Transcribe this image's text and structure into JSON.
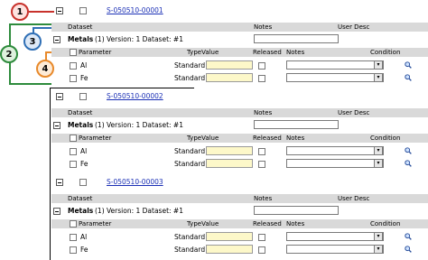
{
  "callouts": {
    "c1": "1",
    "c2": "2",
    "c3": "3",
    "c4": "4"
  },
  "headers": {
    "dataset": "Dataset",
    "notes": "Notes",
    "user_desc": "User Desc",
    "parameter": "Parameter",
    "typevalue": "TypeValue",
    "released": "Released",
    "notes2": "Notes",
    "condition": "Condition"
  },
  "samples": [
    {
      "id": "S-050510-00001",
      "dataset_name": "Metals",
      "dataset_meta": " (1) Version: 1 Dataset: #1",
      "params": [
        {
          "name": "Al",
          "type": "Standard"
        },
        {
          "name": "Fe",
          "type": "Standard"
        }
      ]
    },
    {
      "id": "S-050510-00002",
      "dataset_name": "Metals",
      "dataset_meta": " (1) Version: 1 Dataset: #1",
      "params": [
        {
          "name": "Al",
          "type": "Standard"
        },
        {
          "name": "Fe",
          "type": "Standard"
        }
      ]
    },
    {
      "id": "S-050510-00003",
      "dataset_name": "Metals",
      "dataset_meta": " (1) Version: 1 Dataset: #1",
      "params": [
        {
          "name": "Al",
          "type": "Standard"
        },
        {
          "name": "Fe",
          "type": "Standard"
        }
      ]
    }
  ],
  "icons": {
    "search": "magnifier-icon",
    "dropdown": "dropdown-arrow-icon"
  },
  "colors": {
    "callout1": "#c8322c",
    "callout2": "#2e8b3c",
    "callout3": "#2f6fb5",
    "callout4": "#e8892a",
    "link": "#1a2fb5",
    "header_bg": "#d9d9d9",
    "input_yellow": "#fdf8c9"
  }
}
